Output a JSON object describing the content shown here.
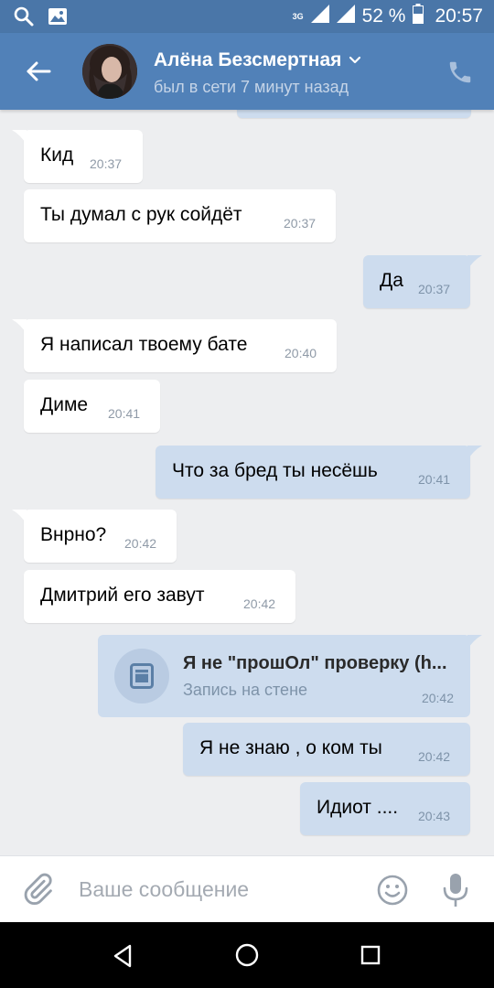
{
  "status_bar": {
    "battery": "52 %",
    "time": "20:57",
    "network": "3G"
  },
  "header": {
    "contact_name": "Алёна Безсмертная",
    "status": "был в сети 7 минут назад"
  },
  "messages": [
    {
      "text": "Кид",
      "time": "20:37",
      "direction": "in"
    },
    {
      "text": "Ты думал с рук сойдёт",
      "time": "20:37",
      "direction": "in"
    },
    {
      "text": "Да",
      "time": "20:37",
      "direction": "out"
    },
    {
      "text": "Я написал твоему бате",
      "time": "20:40",
      "direction": "in"
    },
    {
      "text": "Диме",
      "time": "20:41",
      "direction": "in"
    },
    {
      "text": "Что за бред ты несёшь",
      "time": "20:41",
      "direction": "out"
    },
    {
      "text": "Внрно?",
      "time": "20:42",
      "direction": "in"
    },
    {
      "text": "Дмитрий его завут",
      "time": "20:42",
      "direction": "in"
    },
    {
      "text": "Я не знаю , о ком ты",
      "time": "20:42",
      "direction": "out"
    },
    {
      "text": "Идиот ....",
      "time": "20:43",
      "direction": "out"
    }
  ],
  "wall_post": {
    "title": "Я не \"прошОл\" проверку (h...",
    "subtitle": "Запись на стене",
    "time": "20:42"
  },
  "input": {
    "placeholder": "Ваше сообщение"
  },
  "colors": {
    "header": "#5181b8",
    "status_bar": "#4a76a8",
    "incoming_bubble": "#ffffff",
    "outgoing_bubble": "#cddcee",
    "chat_background": "#edeef0"
  }
}
